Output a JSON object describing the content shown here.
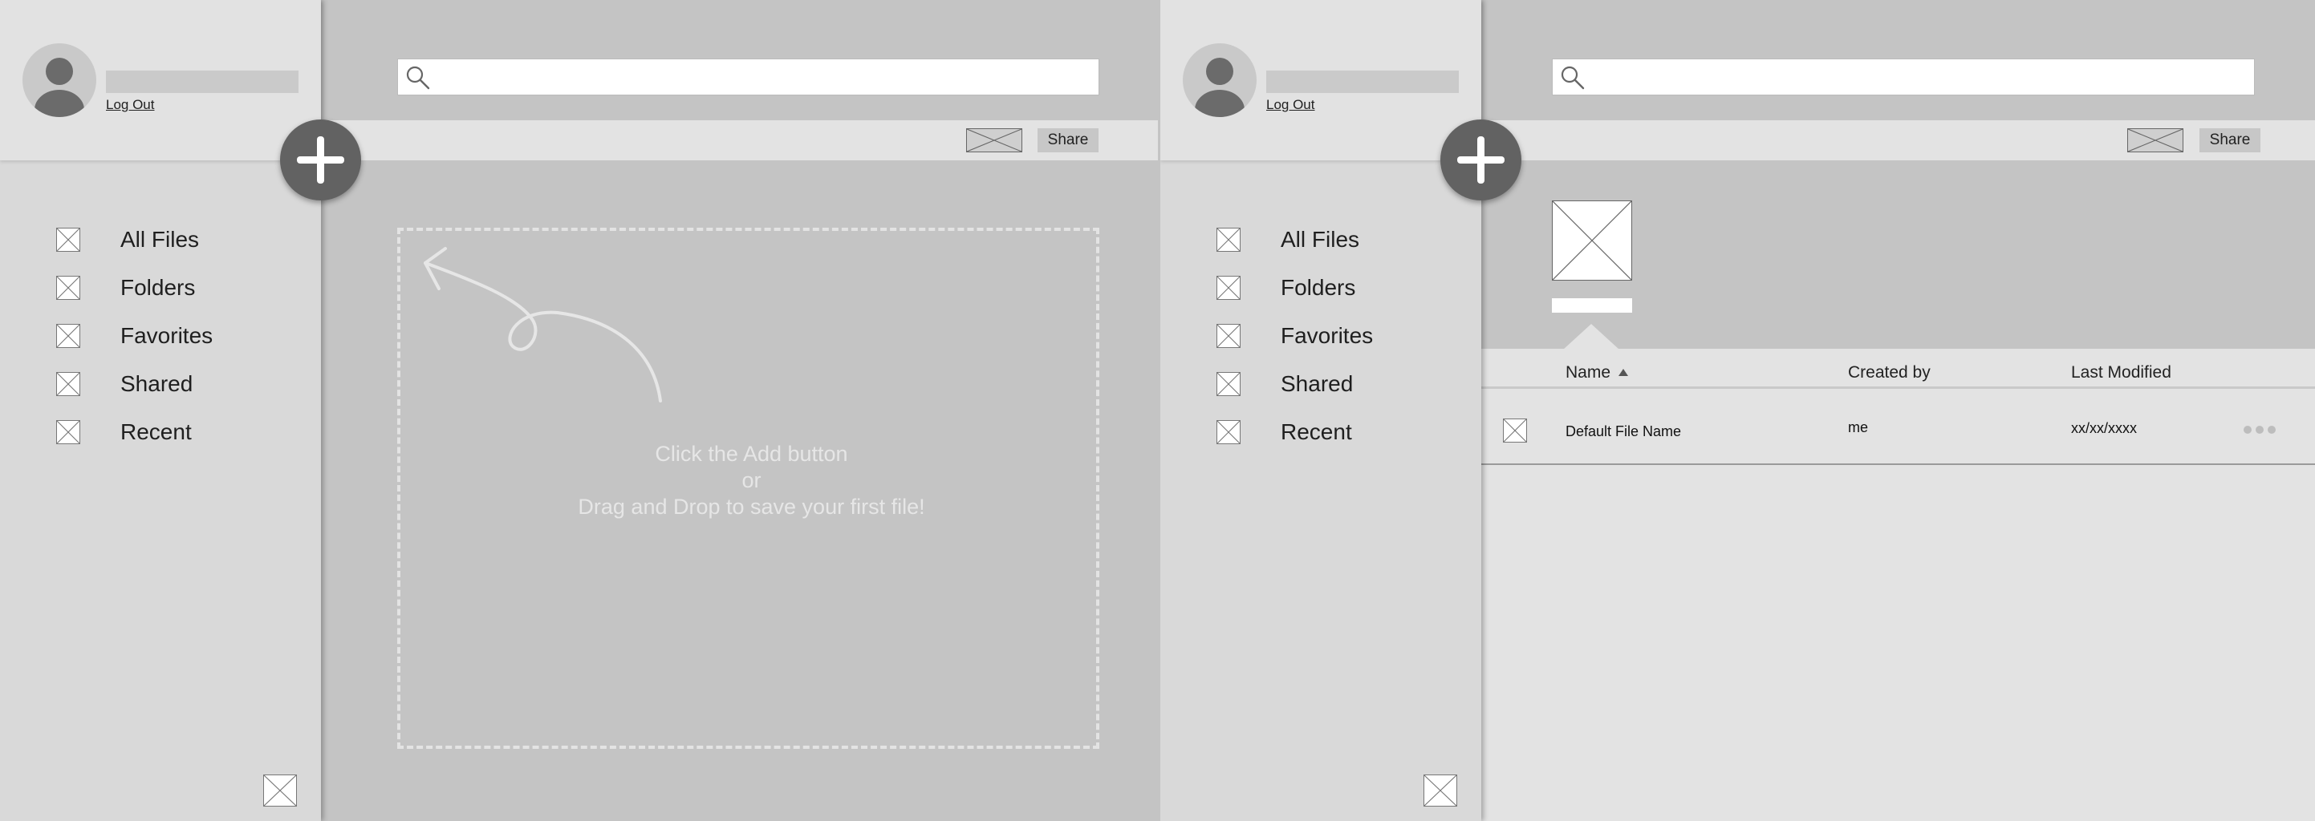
{
  "user": {
    "logout_label": "Log Out"
  },
  "nav": {
    "items": [
      {
        "label": "All Files",
        "icon": "image-placeholder-icon"
      },
      {
        "label": "Folders",
        "icon": "image-placeholder-icon"
      },
      {
        "label": "Favorites",
        "icon": "image-placeholder-icon"
      },
      {
        "label": "Shared",
        "icon": "image-placeholder-icon"
      },
      {
        "label": "Recent",
        "icon": "image-placeholder-icon"
      }
    ]
  },
  "search": {
    "placeholder": "",
    "icon": "search-icon"
  },
  "toolbar": {
    "share_label": "Share"
  },
  "empty_state": {
    "line1": "Click the Add button",
    "line2": "or",
    "line3": "Drag and Drop to save your first file!"
  },
  "file_list": {
    "columns": {
      "name": "Name",
      "created_by": "Created by",
      "last_modified": "Last Modified"
    },
    "sort": {
      "column": "Name",
      "direction": "ascending"
    },
    "rows": [
      {
        "name": "Default File Name",
        "created_by": "me",
        "last_modified": "xx/xx/xxxx"
      }
    ]
  },
  "colors": {
    "sidebar_bg": "#d9d9d9",
    "main_bg": "#c4c4c4",
    "fab_bg": "#626262",
    "toolbar_bg": "#e3e3e3"
  }
}
